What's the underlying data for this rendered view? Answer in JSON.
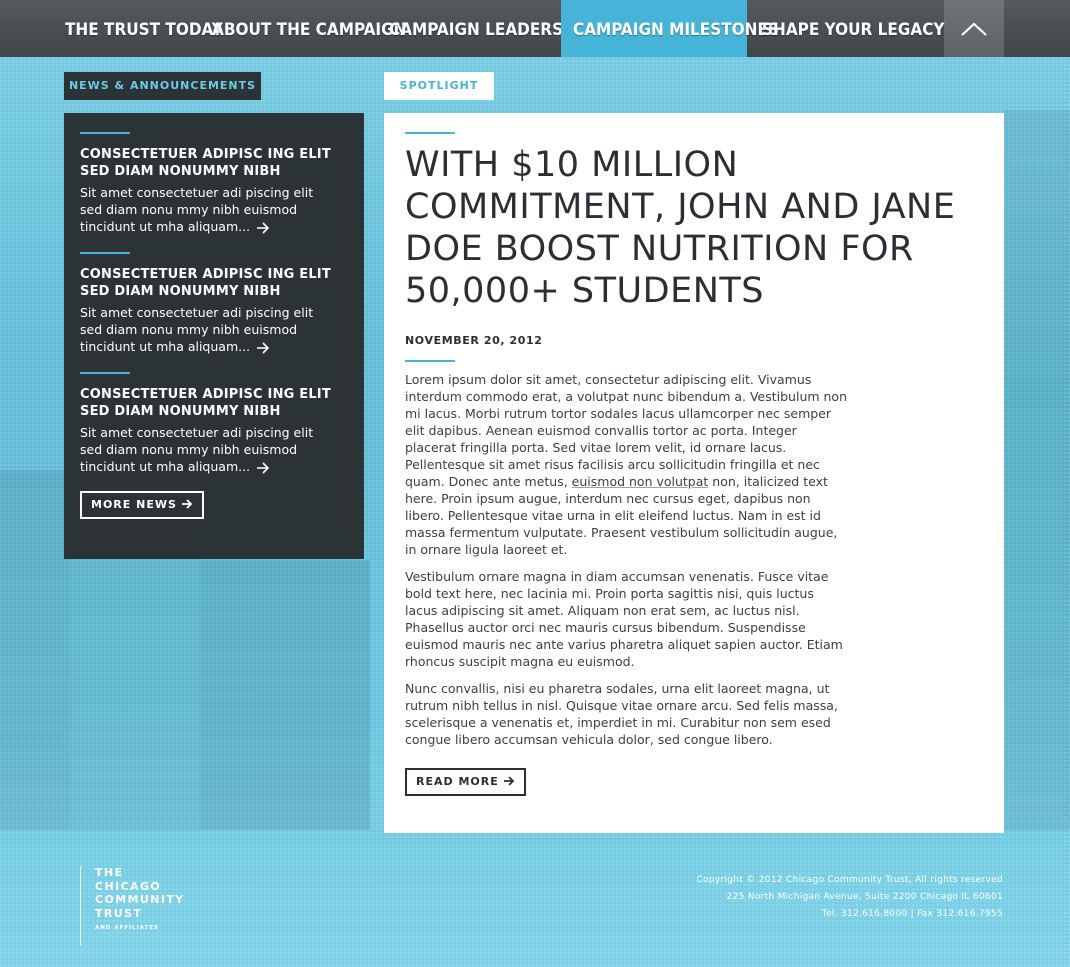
{
  "nav": {
    "items": [
      {
        "label": "THE TRUST TODAY",
        "active": false
      },
      {
        "label": "ABOUT THE CAMPAIGN",
        "active": false
      },
      {
        "label": "CAMPAIGN LEADERSHIP",
        "active": false
      },
      {
        "label": "CAMPAIGN MILESTONES",
        "active": true
      },
      {
        "label": "SHAPE YOUR LEGACY",
        "active": false
      }
    ],
    "up_icon": "chevron-up-icon"
  },
  "news": {
    "tab_label": "NEWS & ANNOUNCEMENTS",
    "items": [
      {
        "title": "CONSECTETUER ADIPISC ING ELIT SED DIAM NONUMMY NIBH",
        "body": "Sit amet consectetuer adi piscing elit sed diam nonu mmy nibh euismod tincidunt ut mha aliquam..."
      },
      {
        "title": "CONSECTETUER ADIPISC ING ELIT SED DIAM NONUMMY NIBH",
        "body": "Sit amet consectetuer adi piscing elit sed diam nonu mmy nibh euismod tincidunt ut mha aliquam..."
      },
      {
        "title": "CONSECTETUER ADIPISC ING ELIT SED DIAM NONUMMY NIBH",
        "body": "Sit amet consectetuer adi piscing elit sed diam nonu mmy nibh euismod tincidunt ut mha aliquam..."
      }
    ],
    "more_label": "MORE NEWS"
  },
  "spotlight": {
    "tab_label": "SPOTLIGHT",
    "headline": "WITH $10 MILLION COMMITMENT, JOHN AND JANE DOE BOOST NUTRITION FOR 50,000+ STUDENTS",
    "date": "NOVEMBER 20, 2012",
    "para1_before": "Lorem ipsum dolor sit amet, consectetur adipiscing elit. Vivamus interdum commodo erat, a volutpat nunc bibendum a. Vestibulum non mi lacus. Morbi rutrum tortor sodales lacus ullamcorper nec semper elit dapibus. Aenean euismod convallis tortor ac porta. Integer placerat fringilla porta. Sed vitae lorem velit, id ornare lacus. Pellentesque sit amet risus facilisis arcu sollicitudin fringilla et nec quam. Donec ante metus, ",
    "para1_link": "euismod non volutpat",
    "para1_after": " non, italicized text here. Proin ipsum augue, interdum nec cursus eget, dapibus non libero. Pellentesque vitae urna in elit eleifend luctus. Nam in est id massa fermentum vulputate. Praesent vestibulum sollicitudin augue, in ornare ligula laoreet et.",
    "para2": "Vestibulum ornare magna in diam accumsan venenatis. Fusce vitae bold text here, nec lacinia mi. Proin porta sagittis nisi, quis luctus lacus adipiscing sit amet. Aliquam non erat sem, ac luctus nisl. Phasellus auctor orci nec mauris cursus bibendum. Suspendisse euismod mauris nec ante varius pharetra aliquet sapien auctor. Etiam rhoncus suscipit magna eu euismod.",
    "para3": "Nunc convallis, nisi eu pharetra sodales, urna elit laoreet magna, ut rutrum nibh tellus in nisl. Quisque vitae ornare arcu. Sed felis massa, scelerisque a venenatis et, imperdiet in mi. Curabitur non sem esed congue libero accumsan vehicula dolor, sed congue libero.",
    "read_more_label": "READ MORE"
  },
  "footer": {
    "logo_lines": [
      "THE",
      "CHICAGO",
      "COMMUNITY",
      "TRUST"
    ],
    "logo_sub": "AND AFFILIATES",
    "copyright": "Copyright © 2012 Chicago Community Trust, All rights reserved",
    "address": "225 North Michigan Avenue, Suite 2200 Chicago IL 60601",
    "phone": "Tel. 312.616.8000  | Fax 312.616.7955"
  },
  "colors": {
    "accent": "#46b4d8",
    "dark_panel": "#2c3337",
    "nav_bg": "#4a5054",
    "background": "#6ac6df"
  }
}
